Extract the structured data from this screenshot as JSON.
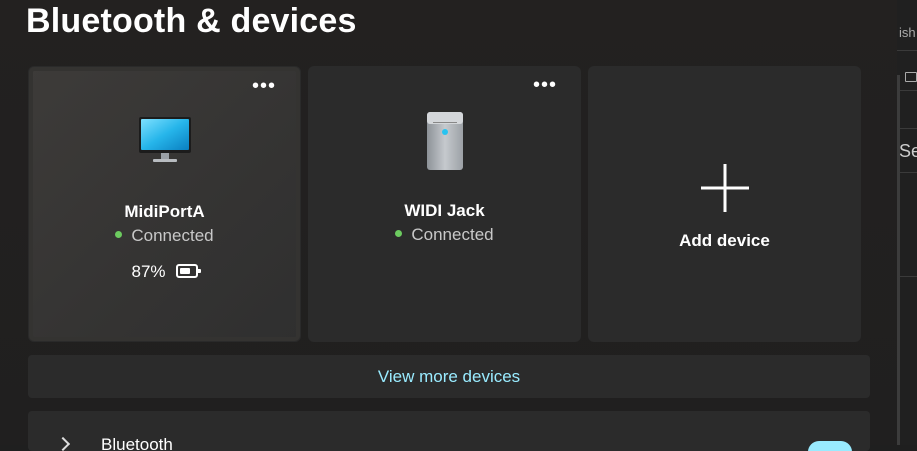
{
  "page": {
    "title": "Bluetooth & devices"
  },
  "devices": [
    {
      "name": "MidiPortA",
      "status": "Connected",
      "battery": "87%",
      "icon": "monitor-icon",
      "more_label": "•••"
    },
    {
      "name": "WIDI Jack",
      "status": "Connected",
      "icon": "tower-computer-icon",
      "more_label": "•••"
    }
  ],
  "add_device": {
    "label": "Add device",
    "icon": "plus-icon"
  },
  "view_more": {
    "label": "View more devices"
  },
  "bluetooth_section": {
    "label": "Bluetooth",
    "toggle_on": true,
    "icon": "bluetooth-icon"
  },
  "right_strip": {
    "text_top": "ish",
    "text_mid": "Se"
  },
  "colors": {
    "accent": "#99ebff",
    "status_green": "#6ccb5f",
    "card_bg": "#2b2b2b",
    "page_bg": "#202020"
  }
}
